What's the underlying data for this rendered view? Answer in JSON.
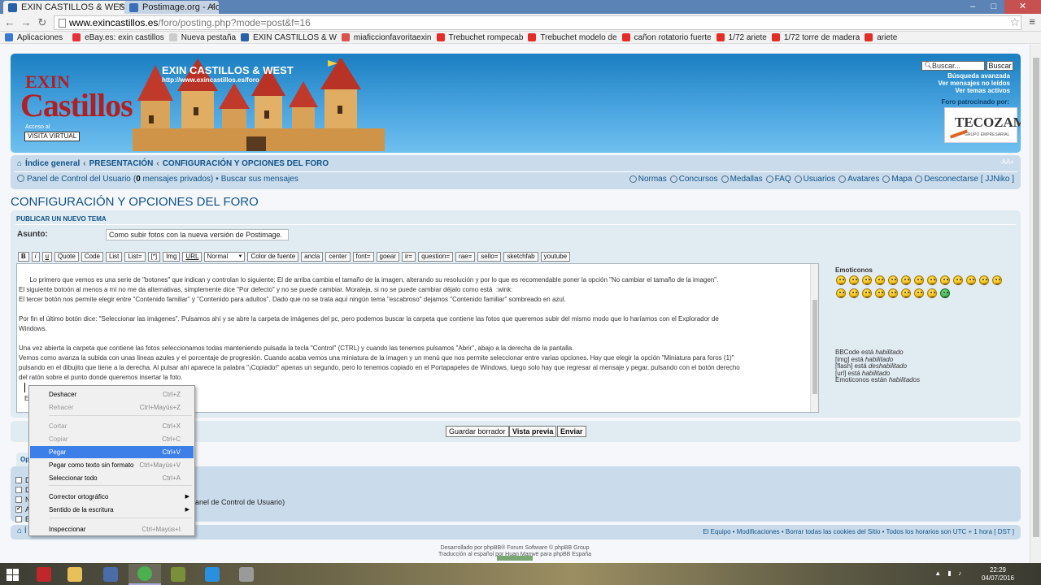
{
  "browser": {
    "tabs": [
      {
        "title": "EXIN CASTILLOS & WEST",
        "active": true
      },
      {
        "title": "Postimage.org - Alojamie",
        "active": false
      }
    ],
    "url_host": "www.exincastillos.es",
    "url_path": "/foro/posting.php?mode=post&f=16",
    "window_buttons": {
      "minimize": "–",
      "maximize": "□",
      "close": "✕"
    },
    "bookmarks": [
      {
        "label": "Aplicaciones",
        "icon": "apps-icon",
        "color": "#3a78d4"
      },
      {
        "label": "eBay.es: exin castillos",
        "icon": "ebay-icon",
        "color": "#e53238"
      },
      {
        "label": "Nueva pestaña",
        "icon": "page-icon",
        "color": "#cccccc"
      },
      {
        "label": "EXIN CASTILLOS & W",
        "icon": "forum-icon",
        "color": "#2b5fa8"
      },
      {
        "label": "miaficcionfavoritaexin",
        "icon": "blog-icon",
        "color": "#d9534f"
      },
      {
        "label": "Trebuchet rompecab",
        "icon": "video-icon",
        "color": "#e52d27"
      },
      {
        "label": "Trebuchet modelo de",
        "icon": "video-icon",
        "color": "#e52d27"
      },
      {
        "label": "cañon rotatorio fuerte",
        "icon": "video-icon",
        "color": "#e52d27"
      },
      {
        "label": "1/72 ariete",
        "icon": "video-icon",
        "color": "#e52d27"
      },
      {
        "label": "1/72 torre de madera",
        "icon": "video-icon",
        "color": "#e52d27"
      },
      {
        "label": "ariete",
        "icon": "video-icon",
        "color": "#e52d27"
      }
    ]
  },
  "header": {
    "logo_exin": "EXIN",
    "logo_castillos": "Castillos",
    "access_label": "Acceso al",
    "visita_button": "VISITA VIRTUAL",
    "site_title": "EXIN CASTILLOS & WEST",
    "site_url": "http://www.exincastillos.es/foro",
    "search_placeholder": "Buscar...",
    "search_button": "Buscar",
    "advanced_search": "Búsqueda avanzada",
    "unread_posts": "Ver mensajes no leídos",
    "active_topics": "Ver temas activos",
    "sponsor_label": "Foro patrocinado por:",
    "sponsor_name": "TECOZAM",
    "sponsor_sub": "GRUPO EMPRESARIAL"
  },
  "nav": {
    "crumbs": [
      "Índice general",
      "PRESENTACIÓN",
      "CONFIGURACIÓN Y OPCIONES DEL FORO"
    ],
    "crumb_separator": "‹",
    "fontsize": "-AA+",
    "ucp": "Panel de Control del Usuario",
    "private_open": "(",
    "private_count": "0",
    "private_label": "mensajes privados)",
    "bullet": "•",
    "own_posts": "Buscar sus mensajes",
    "right_links": [
      "Normas",
      "Concursos",
      "Medallas",
      "FAQ",
      "Usuarios",
      "Avatares",
      "Mapa",
      "Desconectarse [ JJNiko ]"
    ]
  },
  "main": {
    "page_title": "CONFIGURACIÓN Y OPCIONES DEL FORO",
    "panel_heading": "PUBLICAR UN NUEVO TEMA",
    "subject_label": "Asunto:",
    "subject_value": "Como subir fotos con la nueva versión de Postimage.",
    "toolbar_buttons": [
      "B",
      "i",
      "u",
      "Quote",
      "Code",
      "List",
      "List=",
      "[*]",
      "Img",
      "URL"
    ],
    "fontsize_select": "Normal",
    "toolbar_buttons2": [
      "Color de fuente",
      "ancla",
      "center",
      "font=",
      "goear",
      "ir=",
      "question=",
      "rae=",
      "sello=",
      "sketchfab",
      "youtube"
    ],
    "message": "Lo primero que vemos es una serie de \"botones\" que indican y controlan lo siguiente: El de arriba cambia el tamaño de la imagen, alterando su resolución y por lo que es recomendable poner la opción \"No cambiar el tamaño de la imagen\".\nEl siguiente botoón al menos a mí no me da alternativas, simplemente dice \"Por defecto\" y no se puede cambiar. Moraleja, si no se puede cambiar déjalo como está  :wink:\nEl tercer botón nos permite elegir entre \"Contenido familiar\" y \"Contenido para adultos\". Dado que no se trata aquí ningún tema \"escabroso\" dejamos \"Contenido familiar\" sombreado en azul.\n\nPor fin el último botón dice: \"Seleccionar las imágenes\". Pulsamos ahí y se abre la carpeta de imágenes del pc, pero podemos buscar la carpeta que contiene las fotos que queremos subir del mismo modo que lo haríamos con el Explorador de\nWindows.\n\nUna vez abierta la carpeta que contiene las fotos seleccionamos todas manteniendo pulsada la tecla \"Control\" (CTRL) y cuando las tenemos pulsamos \"Abrir\", abajo a la derecha de la pantalla.\nVemos como avanza la subida con unas lineas azules y el porcentaje de progresión. Cuando acaba vemos una miniatura de la imagen y un menú que nos permite seleccionar entre varias opciones. Hay que elegir la opción \"Miniatura para foros (1)\"\npulsando en el dibujito que tiene a la derecha. Al pulsar ahí aparece la palabra \"¡Copiado!\" apenas un segundo, pero lo tenemos copiado en el Portapapeles de Windows, luego solo hay que regresar al mensaje y pegar, pulsando con el botón derecho\ndel ratón sobre el punto donde queremos insertar la foto.",
    "message_partial": "Esp",
    "smilies_title": "Emoticonos",
    "smilies_count": 22,
    "bbcode_status": [
      {
        "label": "BBCode está ",
        "state": "habilitado"
      },
      {
        "label": "[img] está ",
        "state": "habilitado"
      },
      {
        "label": "[flash] está ",
        "state": "deshabilitado"
      },
      {
        "label": "[url] está ",
        "state": "habilitado"
      },
      {
        "label": "Emoticonos están ",
        "state": "habilitados"
      }
    ],
    "buttons": {
      "draft": "Guardar borrador",
      "preview": "Vista previa",
      "submit": "Enviar"
    },
    "options_tab": "Op",
    "options_rows": [
      {
        "label": "D",
        "checked": false
      },
      {
        "label": "D",
        "checked": false
      },
      {
        "label": "N",
        "checked": false
      },
      {
        "label": "A",
        "checked": true
      },
      {
        "label": "E",
        "checked": false
      }
    ],
    "ucp_note": "anel de Control de Usuario)"
  },
  "footer": {
    "home": "Í",
    "links": "El Equipo • Modificaciones • Borrar todas las cookies del Sitio • Todos los horarios son UTC + 1 hora [ DST ]",
    "powered": "Desarrollado por phpBB® Forum Software © phpBB Group",
    "translation": "Traducción al español por Huan Manwë para phpBB España"
  },
  "context_menu": [
    {
      "label": "Deshacer",
      "shortcut": "Ctrl+Z",
      "state": "normal"
    },
    {
      "label": "Rehacer",
      "shortcut": "Ctrl+Mayús+Z",
      "state": "disabled"
    },
    {
      "label": "Cortar",
      "shortcut": "Ctrl+X",
      "state": "disabled"
    },
    {
      "label": "Copiar",
      "shortcut": "Ctrl+C",
      "state": "disabled"
    },
    {
      "label": "Pegar",
      "shortcut": "Ctrl+V",
      "state": "highlight"
    },
    {
      "label": "Pegar como texto sin formato",
      "shortcut": "Ctrl+Mayús+V",
      "state": "normal"
    },
    {
      "label": "Seleccionar todo",
      "shortcut": "Ctrl+A",
      "state": "normal"
    },
    {
      "label": "Corrector ortográfico",
      "shortcut": "",
      "state": "submenu"
    },
    {
      "label": "Sentido de la escritura",
      "shortcut": "",
      "state": "submenu"
    },
    {
      "label": "Inspeccionar",
      "shortcut": "Ctrl+Mayús+I",
      "state": "normal"
    }
  ],
  "taskbar": {
    "apps": [
      {
        "name": "power-app-icon",
        "color": "#c0272d"
      },
      {
        "name": "file-explorer-icon",
        "color": "#e8c05a"
      },
      {
        "name": "settings-app-icon",
        "color": "#4a6da8"
      },
      {
        "name": "chrome-icon",
        "color": "#4caf50"
      },
      {
        "name": "font-app-icon",
        "color": "#7a8f3a"
      },
      {
        "name": "internet-explorer-icon",
        "color": "#2a8fe0"
      },
      {
        "name": "paint-app-icon",
        "color": "#9a9a9a"
      }
    ],
    "time": "22:29",
    "date": "04/07/2016"
  }
}
